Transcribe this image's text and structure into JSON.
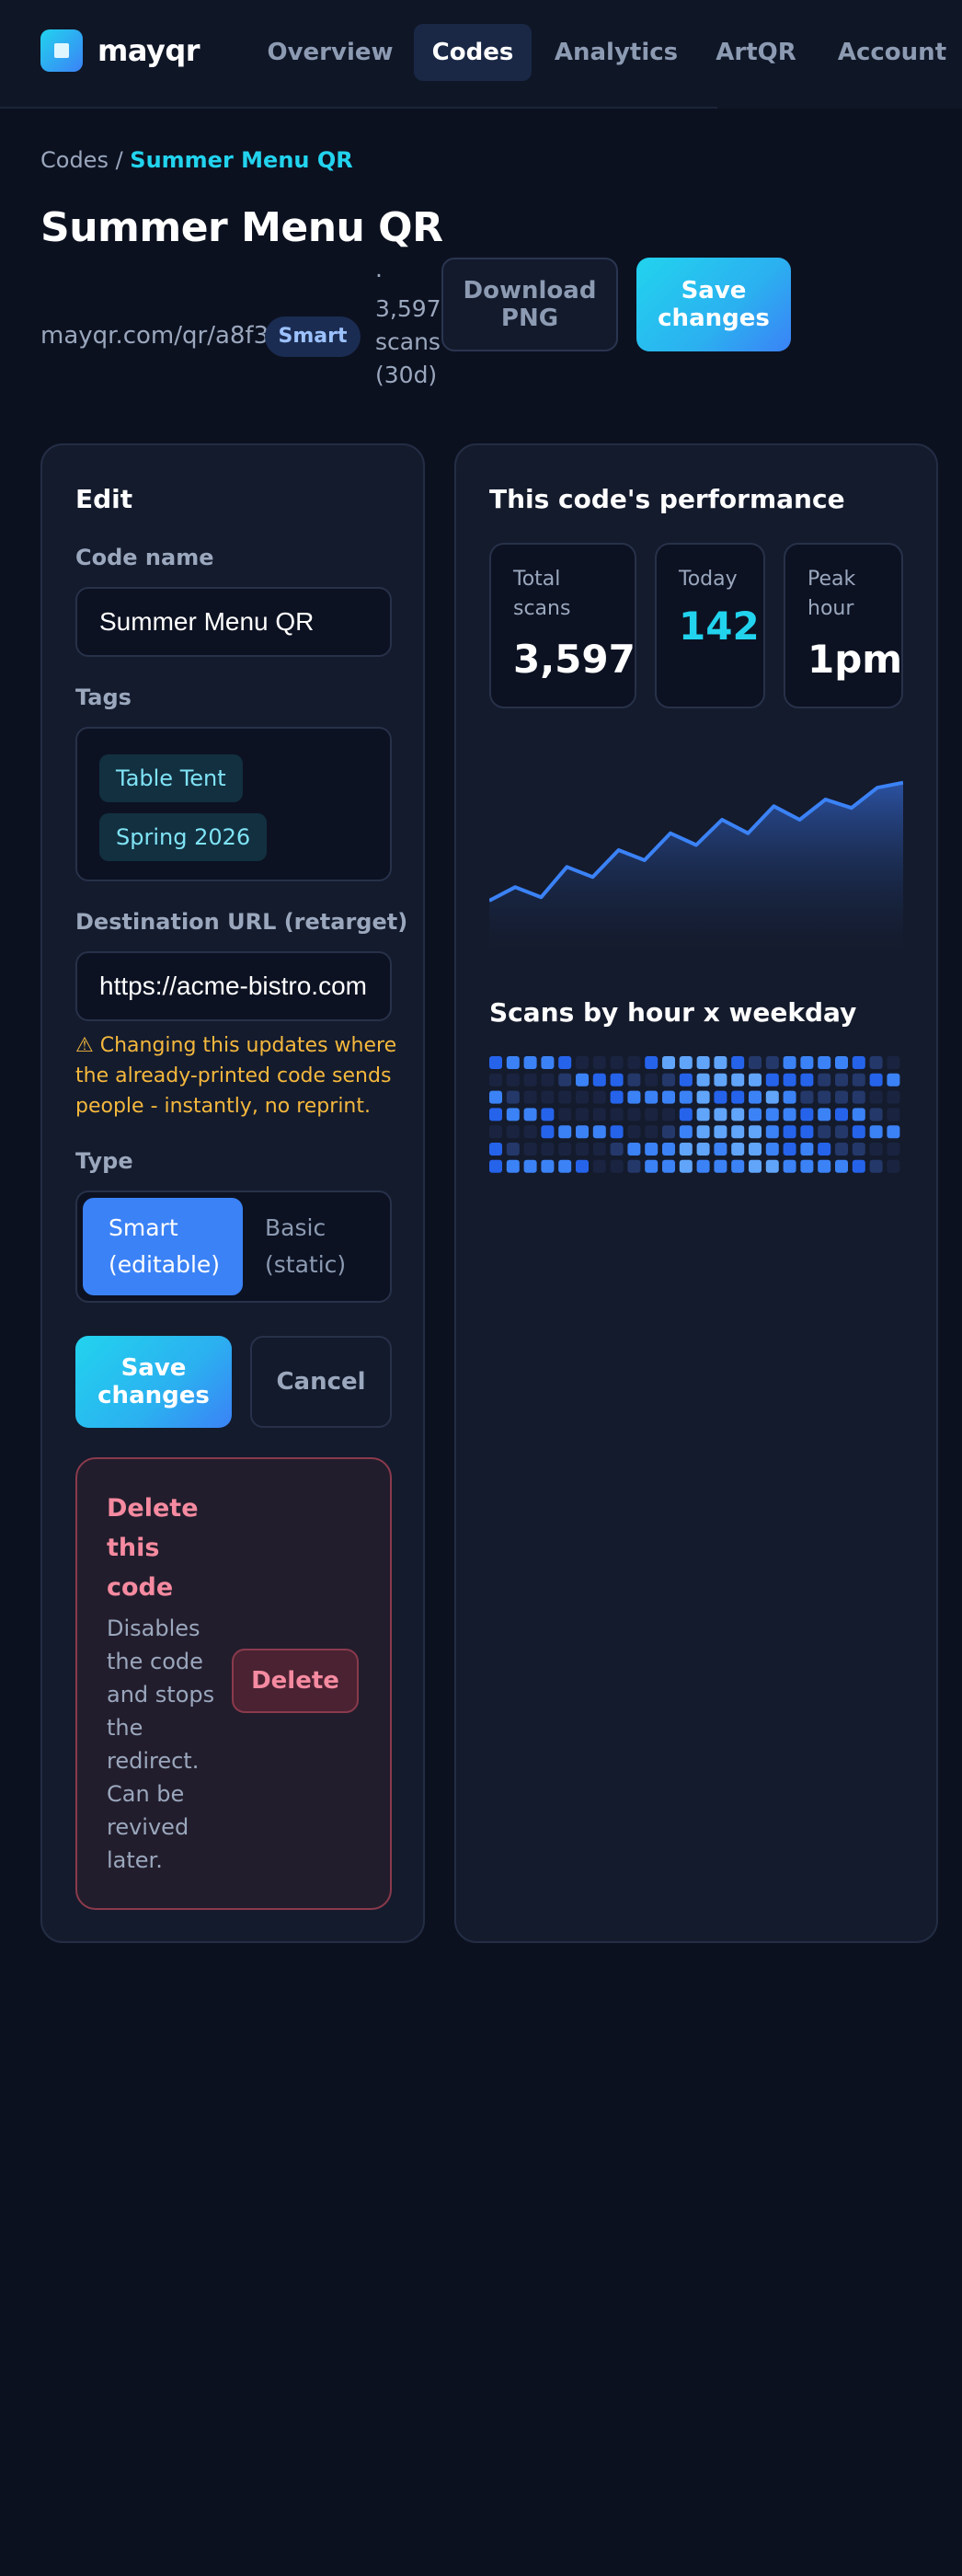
{
  "brand": {
    "name": "mayqr",
    "logo_icon": "qr-logo-icon"
  },
  "nav": {
    "items": [
      {
        "label": "Overview",
        "active": false
      },
      {
        "label": "Codes",
        "active": true
      },
      {
        "label": "Analytics",
        "active": false
      },
      {
        "label": "ArtQR",
        "active": false
      },
      {
        "label": "Account",
        "active": false
      }
    ]
  },
  "breadcrumb": {
    "parent": "Codes",
    "separator": " / ",
    "current": "Summer Menu QR"
  },
  "header": {
    "title": "Summer Menu QR",
    "short_url": "mayqr.com/qr/a8f3",
    "badge": "Smart",
    "scan_meta_lines": [
      "·",
      "3,597",
      "scans",
      "(30d)"
    ],
    "download_label_lines": [
      "Download",
      "PNG"
    ],
    "save_label_lines": [
      "Save",
      "changes"
    ]
  },
  "edit": {
    "title": "Edit",
    "name_label": "Code name",
    "name_value": "Summer Menu QR",
    "tags_label": "Tags",
    "tags": [
      "Table Tent",
      "Spring 2026"
    ],
    "url_label": "Destination URL (retarget)",
    "url_value": "https://acme-bistro.com",
    "warning_lines": [
      "⚠ Changing this updates where",
      "the already-printed code sends",
      "people - instantly, no reprint."
    ],
    "type_label": "Type",
    "type_options": [
      {
        "lines": [
          "Smart",
          "(editable)"
        ],
        "selected": true
      },
      {
        "lines": [
          "Basic",
          "(static)"
        ],
        "selected": false
      }
    ],
    "save_lines": [
      "Save",
      "changes"
    ],
    "cancel_label": "Cancel",
    "danger": {
      "title_lines": [
        "Delete",
        "this",
        "code"
      ],
      "desc_lines": [
        "Disables",
        "the code",
        "and stops",
        "the",
        "redirect.",
        "Can be",
        "revived",
        "later."
      ],
      "delete_label": "Delete"
    }
  },
  "performance": {
    "title": "This code's performance",
    "stats": [
      {
        "label_lines": [
          "Total",
          "scans"
        ],
        "value": "3,597",
        "accent": false
      },
      {
        "label_lines": [
          "Today"
        ],
        "value": "142",
        "accent": true
      },
      {
        "label_lines": [
          "Peak",
          "hour"
        ],
        "value": "1pm",
        "accent": false
      }
    ],
    "heatmap_title": "Scans by hour x weekday"
  },
  "colors": {
    "accent_cyan": "#22d3ee",
    "accent_blue": "#3b82f6",
    "warning": "#f5b83d",
    "danger": "#f58aa0",
    "background": "#0c1120"
  },
  "chart_data": [
    {
      "type": "area",
      "title": "",
      "x": [
        1,
        2,
        3,
        4,
        5,
        6,
        7,
        8,
        9,
        10,
        11,
        12,
        13,
        14,
        15,
        16,
        17,
        18,
        19,
        20
      ],
      "series": [
        {
          "values": [
            30,
            38,
            32,
            50,
            44,
            60,
            54,
            70,
            63,
            78,
            70,
            86,
            78,
            90,
            85,
            97,
            100
          ]
        }
      ],
      "ylim": [
        0,
        120
      ],
      "grid": false
    },
    {
      "type": "heatmap",
      "title": "Scans by hour x weekday",
      "rows": 7,
      "columns": 24,
      "values": [
        [
          2,
          3,
          3,
          3,
          2,
          0,
          0,
          0,
          0,
          2,
          4,
          4,
          4,
          4,
          2,
          1,
          1,
          3,
          3,
          3,
          3,
          2,
          1,
          0
        ],
        [
          0,
          0,
          0,
          0,
          1,
          3,
          2,
          2,
          1,
          0,
          1,
          2,
          4,
          4,
          4,
          4,
          2,
          2,
          2,
          1,
          1,
          1,
          2,
          3
        ],
        [
          3,
          1,
          0,
          0,
          0,
          0,
          0,
          2,
          3,
          3,
          3,
          3,
          4,
          2,
          2,
          3,
          4,
          3,
          1,
          1,
          1,
          1,
          0,
          0
        ],
        [
          2,
          3,
          3,
          2,
          0,
          0,
          0,
          0,
          0,
          0,
          0,
          2,
          4,
          4,
          4,
          3,
          3,
          3,
          2,
          3,
          2,
          3,
          1,
          0
        ],
        [
          0,
          0,
          0,
          2,
          3,
          3,
          3,
          2,
          0,
          0,
          1,
          3,
          4,
          4,
          4,
          4,
          3,
          2,
          2,
          1,
          1,
          2,
          3,
          3
        ],
        [
          2,
          1,
          0,
          0,
          0,
          0,
          0,
          1,
          3,
          3,
          3,
          4,
          4,
          3,
          4,
          4,
          3,
          2,
          3,
          2,
          1,
          1,
          0,
          0
        ],
        [
          2,
          3,
          3,
          3,
          3,
          2,
          0,
          0,
          1,
          3,
          3,
          4,
          3,
          3,
          3,
          4,
          4,
          3,
          3,
          3,
          3,
          2,
          1,
          0
        ]
      ]
    }
  ]
}
